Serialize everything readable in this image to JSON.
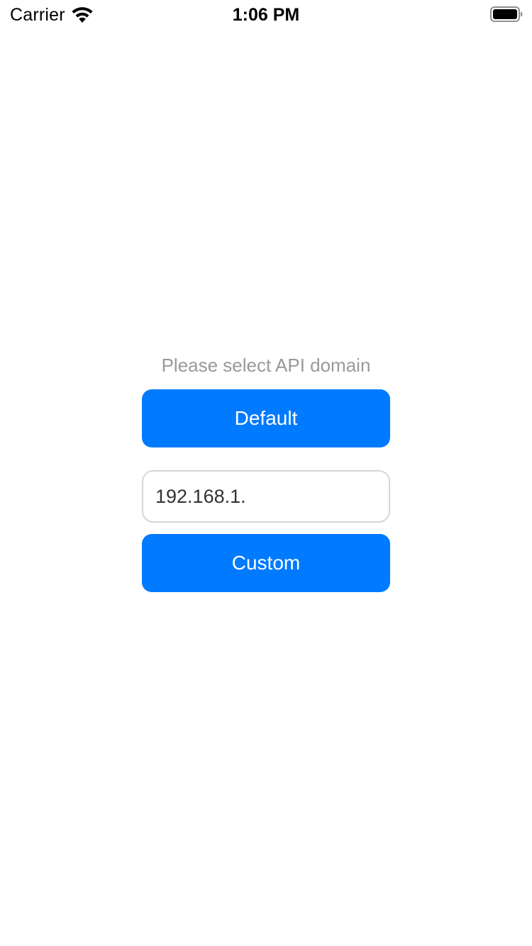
{
  "status_bar": {
    "carrier": "Carrier",
    "time": "1:06 PM",
    "wifi_icon": "wifi-icon",
    "battery_icon": "battery-icon"
  },
  "main": {
    "prompt": "Please select API domain",
    "default_button_label": "Default",
    "domain_input_value": "192.168.1.",
    "custom_button_label": "Custom"
  },
  "colors": {
    "accent": "#007aff",
    "prompt_text": "#999999",
    "input_border": "#d6d6d6",
    "background": "#ffffff"
  }
}
